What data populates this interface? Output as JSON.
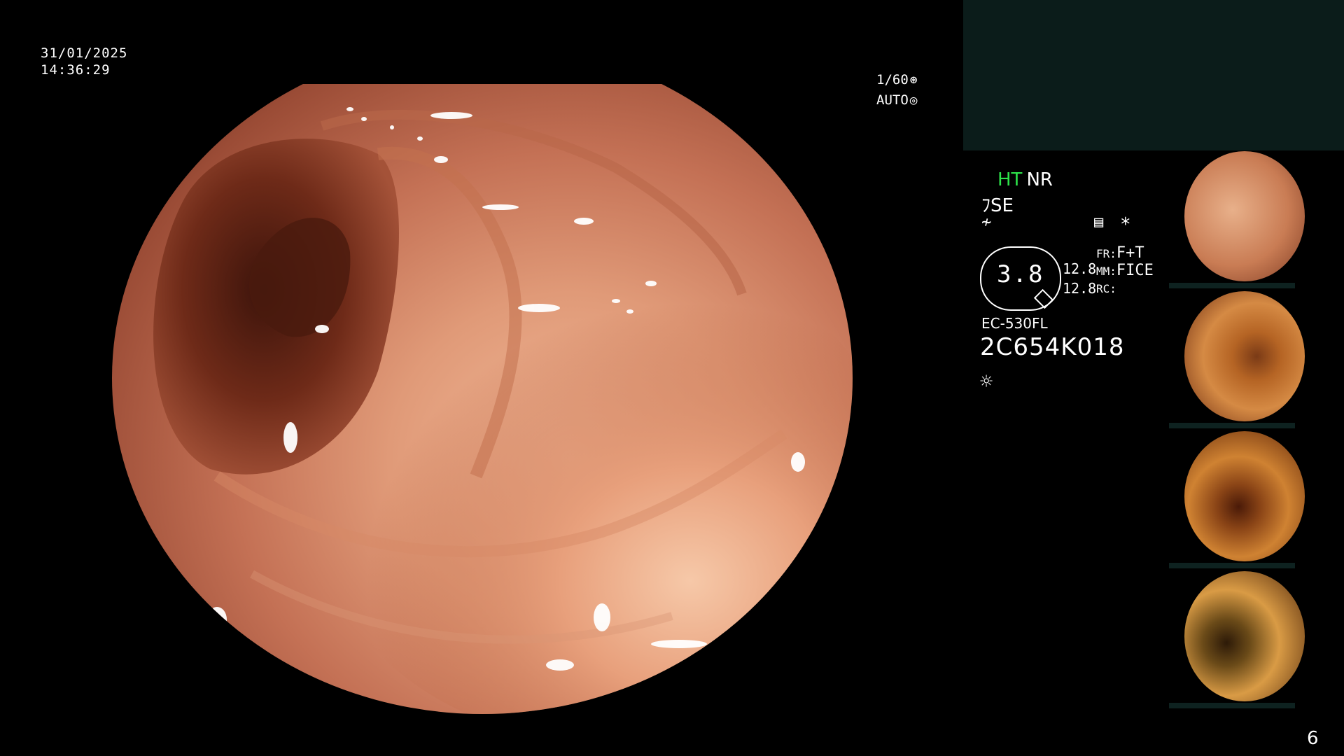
{
  "overlay": {
    "date": "31/01/2025",
    "time": "14:36:29",
    "shutter_speed": "1/60",
    "exposure_mode": "AUTO",
    "shutter_icon": "aperture-icon",
    "exposure_icon": "iris-icon"
  },
  "settings": {
    "ht": "HT",
    "nr": "NR",
    "enhance": "SE",
    "enhance_icon": "structure-enhance-icon",
    "curve_icon": "curve-icon",
    "list_icon": "menu-list-icon",
    "star_icon": "asterisk-icon",
    "gauge_value": "3.8",
    "fr_value_1": "12.8",
    "fr_value_2": "12.8",
    "fr_label": "FR:",
    "fr_mode": "F+T",
    "mm_label": "MM:",
    "mm_mode": "FICE",
    "rc_label": "RC:",
    "rc_mode": ""
  },
  "scope": {
    "model": "EC-530FL",
    "serial": "2C654K018",
    "light_icon": "brightness-icon"
  },
  "thumbnails": [
    {
      "label": "capture-1",
      "color_center": "#e3a27a",
      "color_edge": "#7d3a22"
    },
    {
      "label": "capture-2",
      "color_center": "#d08240",
      "color_edge": "#6a2a10"
    },
    {
      "label": "capture-3",
      "color_center": "#c8782f",
      "color_edge": "#5d2408"
    },
    {
      "label": "capture-4",
      "color_center": "#d89945",
      "color_edge": "#4a2208"
    }
  ],
  "page_number": "6"
}
